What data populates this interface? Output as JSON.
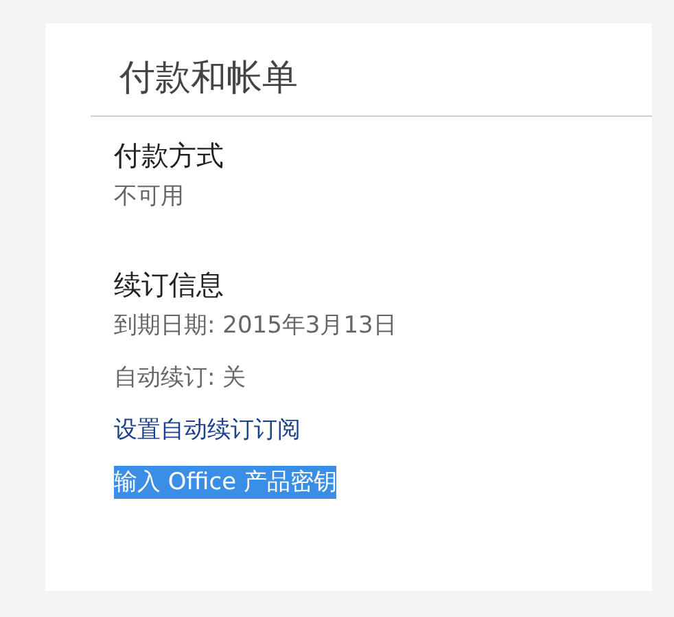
{
  "title": "付款和帐单",
  "sections": [
    {
      "heading": "付款方式",
      "lines": [
        {
          "kind": "text",
          "text": "不可用",
          "selected": false
        }
      ]
    },
    {
      "heading": "续订信息",
      "lines": [
        {
          "kind": "text",
          "text": "到期日期: 2015年3月13日",
          "selected": false
        },
        {
          "kind": "text",
          "text": "自动续订: 关",
          "selected": false
        },
        {
          "kind": "link",
          "text": "设置自动续订订阅",
          "selected": false
        },
        {
          "kind": "link",
          "text": "输入 Office 产品密钥",
          "selected": true
        }
      ]
    }
  ]
}
